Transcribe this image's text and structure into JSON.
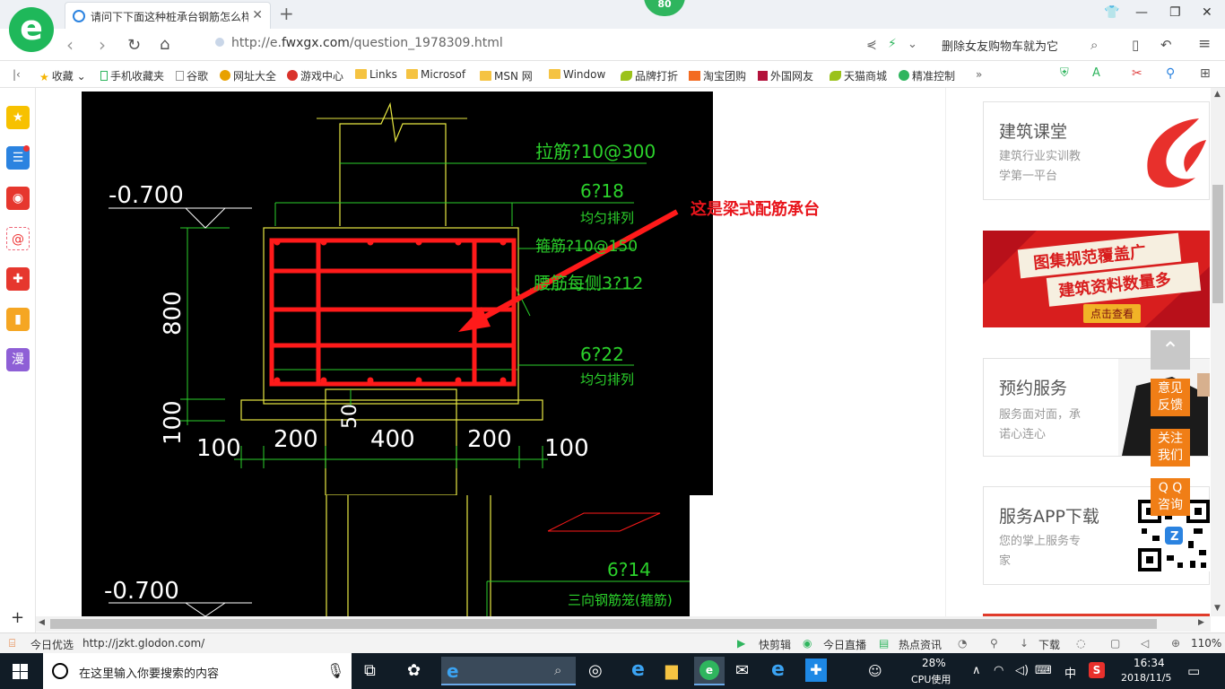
{
  "browser": {
    "logo_glyph": "e",
    "badge": "80",
    "tab_title": "请问下下面这种桩承台钢筋怎么样",
    "new_tab": "+",
    "address_prefix": "http://e.",
    "address_domain": "fwxgx.com",
    "address_path": "/question_1978309.html",
    "search_query": "删除女友购物车就为它"
  },
  "bookmarks": [
    "收藏",
    "手机收藏夹",
    "谷歌",
    "网址大全",
    "游戏中心",
    "Links",
    "Microsof",
    "MSN 网",
    "Window",
    "品牌打折",
    "淘宝团购",
    "外国网友",
    "天猫商城",
    "精准控制"
  ],
  "sidebar": {
    "manga_label": "漫"
  },
  "drawing": {
    "annotation": "这是梁式配筋承台",
    "level_top": "-0.700",
    "level_bottom": "-0.700",
    "tie_bar": "拉筋?10@300",
    "top_bars": "6?18",
    "top_bars_note": "均匀排列",
    "stirrup": "箍筋?10@150",
    "side_bars": "腰筋每侧3?12",
    "bottom_bars": "6?22",
    "bottom_bars_note": "均匀排列",
    "height_dim": "800",
    "base_dim": "100",
    "cover_dim": "50",
    "dims": [
      "100",
      "200",
      "400",
      "200",
      "100"
    ],
    "lower_bars": "6?14",
    "lower_note": "三向钢筋笼(箍筋)"
  },
  "right_column": {
    "course_title": "建筑课堂",
    "course_desc_1": "建筑行业实训教",
    "course_desc_2": "学第一平台",
    "banner_line1": "图集规范覆盖广",
    "banner_line2": "建筑资料数量多",
    "banner_button": "点击查看",
    "service_title": "预约服务",
    "service_desc_1": "服务面对面，承",
    "service_desc_2": "诺心连心",
    "app_title": "服务APP下载",
    "app_desc_1": "您的掌上服务专",
    "app_desc_2": "家"
  },
  "float_buttons": {
    "feedback_1": "意见",
    "feedback_2": "反馈",
    "follow_1": "关注",
    "follow_2": "我们",
    "qq_1": "Q Q",
    "qq_2": "咨询"
  },
  "status_bar": {
    "today_pick": "今日优选",
    "hover_url": "http://jzkt.glodon.com/",
    "quick_edit": "快剪辑",
    "live": "今日直播",
    "hot_news": "热点资讯",
    "download": "下载",
    "zoom": "110%"
  },
  "taskbar": {
    "search_placeholder": "在这里输入你要搜索的内容",
    "cpu_percent": "28%",
    "cpu_label": "CPU使用",
    "ime": "中",
    "time": "16:34",
    "date": "2018/11/5"
  }
}
